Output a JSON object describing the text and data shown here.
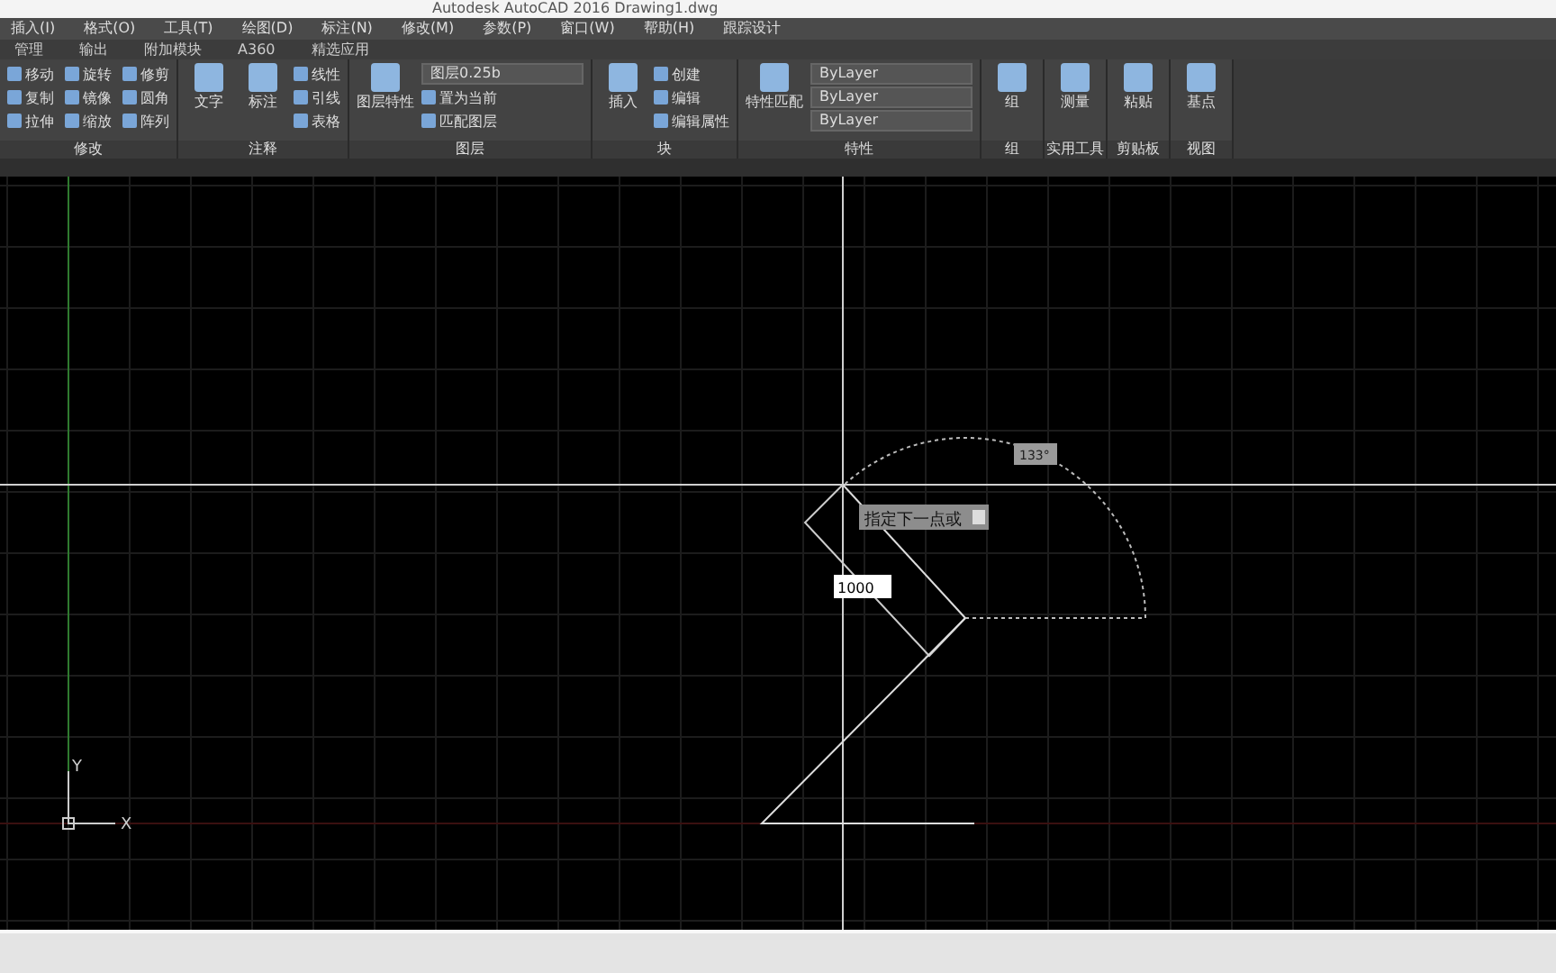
{
  "title_bar": {
    "title": "Autodesk AutoCAD 2016    Drawing1.dwg"
  },
  "menu_bar": [
    "插入(I)",
    "格式(O)",
    "工具(T)",
    "绘图(D)",
    "标注(N)",
    "修改(M)",
    "参数(P)",
    "窗口(W)",
    "帮助(H)",
    "跟踪设计"
  ],
  "ribbon_tabs": [
    {
      "label": "管理",
      "selected": false
    },
    {
      "label": "输出",
      "selected": false
    },
    {
      "label": "附加模块",
      "selected": false
    },
    {
      "label": "A360",
      "selected": false
    },
    {
      "label": "精选应用",
      "selected": false
    }
  ],
  "ribbon_groups": [
    {
      "title": "修改",
      "tools": [
        {
          "kind": "small",
          "label": "移动"
        },
        {
          "kind": "small",
          "label": "复制"
        },
        {
          "kind": "small",
          "label": "拉伸"
        },
        {
          "kind": "small",
          "label": "旋转"
        },
        {
          "kind": "small",
          "label": "镜像"
        },
        {
          "kind": "small",
          "label": "缩放"
        },
        {
          "kind": "small",
          "label": "修剪"
        },
        {
          "kind": "small",
          "label": "圆角"
        },
        {
          "kind": "small",
          "label": "阵列"
        }
      ]
    },
    {
      "title": "注释",
      "tools": [
        {
          "kind": "large",
          "label": "文字"
        },
        {
          "kind": "large",
          "label": "标注"
        },
        {
          "kind": "small",
          "label": "线性"
        },
        {
          "kind": "small",
          "label": "引线"
        },
        {
          "kind": "small",
          "label": "表格"
        }
      ]
    },
    {
      "title": "图层",
      "tools": [
        {
          "kind": "large",
          "label": "图层特性"
        },
        {
          "kind": "dropdown",
          "label": "图层0.25b"
        },
        {
          "kind": "small",
          "label": "置为当前"
        },
        {
          "kind": "small",
          "label": "匹配图层"
        }
      ]
    },
    {
      "title": "块",
      "tools": [
        {
          "kind": "large",
          "label": "插入"
        },
        {
          "kind": "small",
          "label": "创建"
        },
        {
          "kind": "small",
          "label": "编辑"
        },
        {
          "kind": "small",
          "label": "编辑属性"
        }
      ]
    },
    {
      "title": "特性",
      "tools": [
        {
          "kind": "large",
          "label": "特性匹配"
        },
        {
          "kind": "dropdown",
          "label": "ByLayer"
        },
        {
          "kind": "dropdown",
          "label": "ByLayer"
        },
        {
          "kind": "dropdown",
          "label": "ByLayer"
        }
      ]
    },
    {
      "title": "组",
      "tools": [
        {
          "kind": "large",
          "label": "组"
        }
      ]
    },
    {
      "title": "实用工具",
      "tools": [
        {
          "kind": "large",
          "label": "测量"
        }
      ]
    },
    {
      "title": "剪贴板",
      "tools": [
        {
          "kind": "large",
          "label": "粘贴"
        }
      ]
    },
    {
      "title": "视图",
      "tools": [
        {
          "kind": "large",
          "label": "基点"
        }
      ]
    }
  ],
  "canvas": {
    "angle_label": "133°",
    "prompt": "指定下一点或",
    "length_input": "1000",
    "axis_x": "X",
    "axis_y": "Y"
  }
}
